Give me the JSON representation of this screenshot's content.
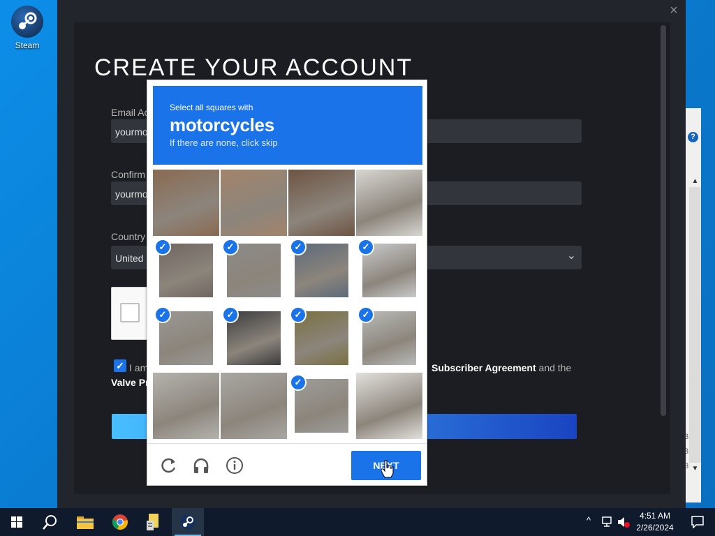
{
  "desktop": {
    "icons": [
      {
        "label": "Steam",
        "icon": "steam-icon"
      }
    ]
  },
  "steam_dialog": {
    "title": "CREATE YOUR ACCOUNT",
    "close_glyph": "×",
    "fields": {
      "email_label": "Email Ac",
      "email_value": "yourmo",
      "confirm_label": "Confirm",
      "confirm_value": "yourmo",
      "country_label": "Country",
      "country_value": "United"
    },
    "agreement": {
      "checked": true,
      "line1_prefix": "I am",
      "line1_link": "Subscriber Agreement",
      "line1_suffix": "and the",
      "line2": "Valve Pr"
    },
    "colors": {
      "background": "#1b1d22",
      "input": "#32353c",
      "button_from": "#47bfff",
      "button_to": "#1a44c2"
    }
  },
  "captcha_challenge": {
    "instruction": "Select all squares with",
    "target": "motorcycles",
    "hint": "If there are none, click skip",
    "tiles": [
      {
        "row": 0,
        "col": 0,
        "selected": false
      },
      {
        "row": 0,
        "col": 1,
        "selected": false
      },
      {
        "row": 0,
        "col": 2,
        "selected": false
      },
      {
        "row": 0,
        "col": 3,
        "selected": false
      },
      {
        "row": 1,
        "col": 0,
        "selected": true
      },
      {
        "row": 1,
        "col": 1,
        "selected": true
      },
      {
        "row": 1,
        "col": 2,
        "selected": true
      },
      {
        "row": 1,
        "col": 3,
        "selected": true
      },
      {
        "row": 2,
        "col": 0,
        "selected": true
      },
      {
        "row": 2,
        "col": 1,
        "selected": true
      },
      {
        "row": 2,
        "col": 2,
        "selected": true
      },
      {
        "row": 2,
        "col": 3,
        "selected": true
      },
      {
        "row": 3,
        "col": 0,
        "selected": false
      },
      {
        "row": 3,
        "col": 1,
        "selected": false
      },
      {
        "row": 3,
        "col": 2,
        "selected": true
      },
      {
        "row": 3,
        "col": 3,
        "selected": false
      }
    ],
    "footer": {
      "reload_icon": "reload-icon",
      "audio_icon": "headphones-icon",
      "info_icon": "info-icon",
      "next_label": "NEXT"
    },
    "colors": {
      "header": "#1a73e8",
      "check": "#1a73e8"
    }
  },
  "background_window": {
    "help_glyph": "?",
    "numbers": [
      "3",
      "3",
      "3"
    ]
  },
  "taskbar": {
    "apps": [
      {
        "name": "start",
        "icon": "windows-logo-icon"
      },
      {
        "name": "search",
        "icon": "search-icon"
      },
      {
        "name": "file-explorer",
        "icon": "folder-icon"
      },
      {
        "name": "chrome",
        "icon": "chrome-icon"
      },
      {
        "name": "app",
        "icon": "document-icon"
      },
      {
        "name": "steam",
        "icon": "steam-icon",
        "active": true
      }
    ],
    "tray": {
      "time": "4:51 AM",
      "date": "2/26/2024"
    }
  }
}
